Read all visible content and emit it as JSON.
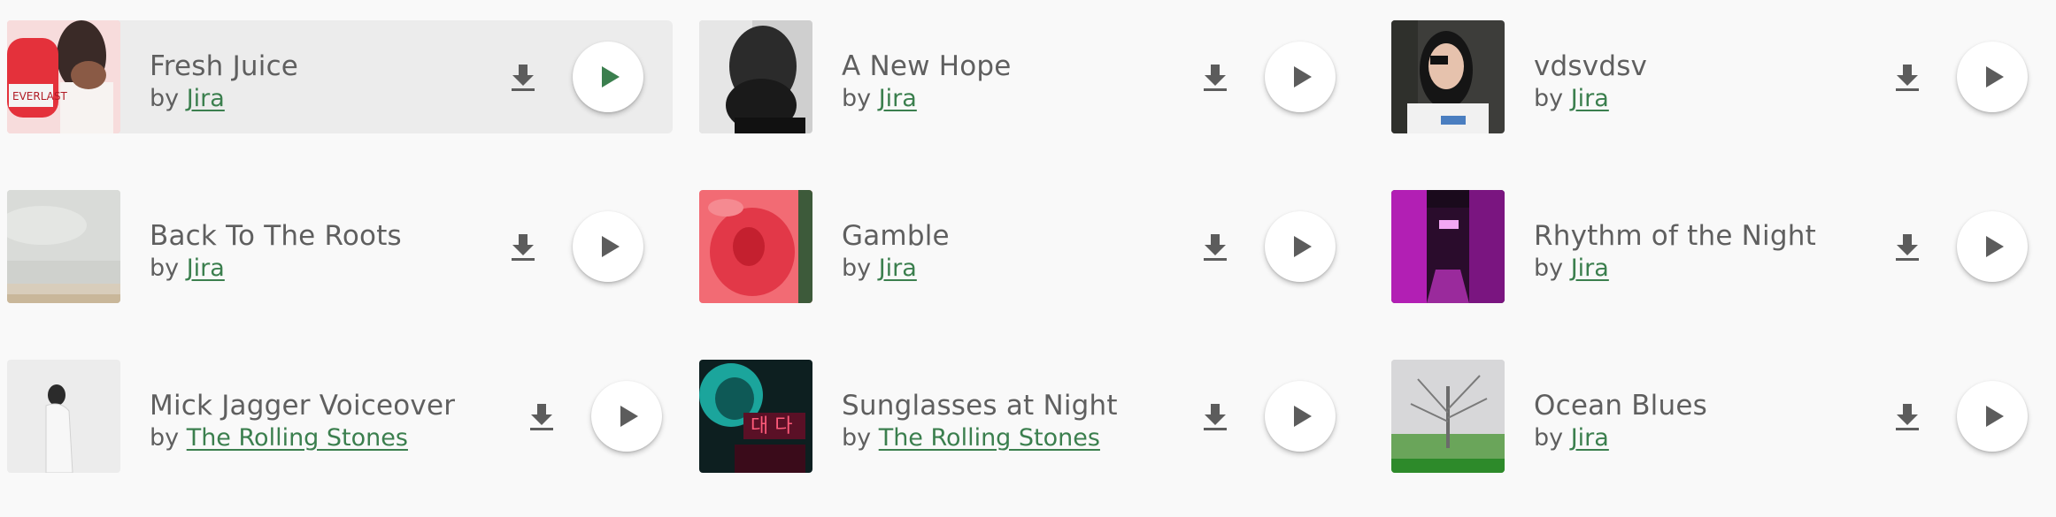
{
  "colors": {
    "accent": "#3b7f4e",
    "text": "#5f5f5f",
    "icon": "#5c5c5c",
    "active_row": "#ececec"
  },
  "icons": {
    "download": "download-icon",
    "play": "play-icon"
  },
  "byline_prefix": "by ",
  "tracks": [
    {
      "title": "Fresh Juice",
      "artist": "Jira",
      "active": true
    },
    {
      "title": "A New Hope",
      "artist": "Jira",
      "active": false
    },
    {
      "title": "vdsvdsv",
      "artist": "Jira",
      "active": false
    },
    {
      "title": "Back To The Roots",
      "artist": "Jira",
      "active": false
    },
    {
      "title": "Gamble",
      "artist": "Jira",
      "active": false
    },
    {
      "title": "Rhythm of the Night",
      "artist": "Jira",
      "active": false
    },
    {
      "title": "Mick Jagger Voiceover",
      "artist": "The Rolling Stones",
      "active": false
    },
    {
      "title": "Sunglasses at Night",
      "artist": "The Rolling Stones",
      "active": false
    },
    {
      "title": "Ocean Blues",
      "artist": "Jira",
      "active": false
    }
  ]
}
